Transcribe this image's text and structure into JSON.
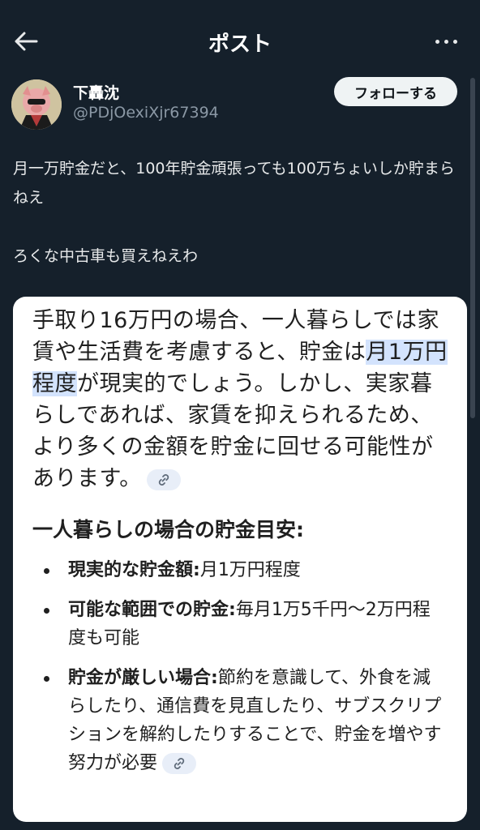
{
  "header": {
    "title": "ポスト"
  },
  "author": {
    "name": "下轟沈",
    "handle": "@PDjOexiXjr67394",
    "follow_label": "フォローする"
  },
  "post": {
    "line1": "月一万貯金だと、100年貯金頑張っても100万ちょいしか貯まらねえ",
    "line2": "ろくな中古車も買えねえわ"
  },
  "card": {
    "para_pre": "手取り16万円の場合、一人暮らしでは家賃や生活費を考慮すると、貯金は",
    "para_highlight": "月1万円程度",
    "para_post": "が現実的でしょう。しかし、実家暮らしであれば、家賃を抑えられるため、より多くの金額を貯金に回せる可能性があります。",
    "heading": "一人暮らしの場合の貯金目安:",
    "bullets": [
      {
        "title": "現実的な貯金額:",
        "body": "月1万円程度"
      },
      {
        "title": "可能な範囲での貯金:",
        "body": "毎月1万5千円〜2万円程度も可能"
      },
      {
        "title": "貯金が厳しい場合:",
        "body": "節約を意識して、外食を減らしたり、通信費を見直したり、サブスクリプションを解約したりすることで、貯金を増やす努力が必要"
      }
    ]
  },
  "icons": {
    "back": "arrow-left-icon",
    "more": "more-horizontal-icon",
    "link": "link-icon"
  },
  "colors": {
    "background": "#15202b",
    "card": "#ffffff",
    "highlight": "#d3e3fd",
    "follow_button": "#eff3f4",
    "secondary_text": "#8b98a5"
  }
}
